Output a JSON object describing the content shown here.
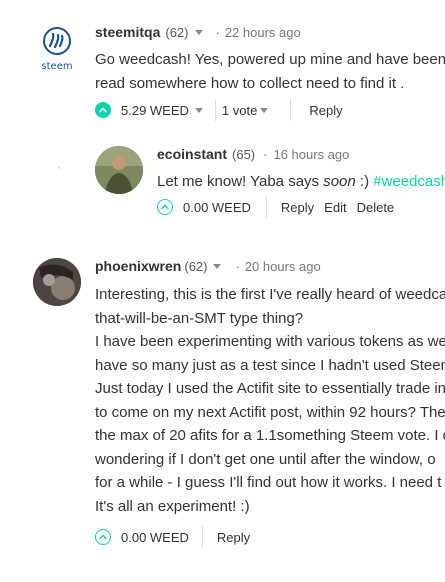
{
  "comments": [
    {
      "author": "steemitqa",
      "rep": "(62)",
      "dot": "·",
      "time": "22 hours ago",
      "avatar_label": "steem",
      "lines": [
        "Go weedcash! Yes, powered up mine and have been",
        "read somewhere how to collect need to find it ."
      ],
      "payout": "5.29 WEED",
      "votes": "1 vote",
      "reply": "Reply"
    },
    {
      "author": "ecoinstant",
      "rep": "(65)",
      "dot": "·",
      "time": "16 hours ago",
      "text_prefix": "Let me know! Yaba says ",
      "text_italic": "soon",
      "text_mid": " :) ",
      "text_tag": "#weedcash",
      "payout": "0.00 WEED",
      "reply": "Reply",
      "edit": "Edit",
      "delete": "Delete"
    },
    {
      "author": "phoenixwren",
      "rep": "(62)",
      "dot": "·",
      "time": "20 hours ago",
      "lines": [
        "Interesting, this is the first I've really heard of weedca",
        "that-will-be-an-SMT type thing?",
        "I have been experimenting with various tokens as we",
        "have so many just as a test since I hadn't used Steem",
        "Just today I used the Actifit site to essentially trade in",
        "to come on my next Actifit post, within 92 hours? The",
        "the max of 20 afits for a 1.1something Steem vote. I c",
        "wondering if I don't get one until after the window, o",
        "for a while - I guess I'll find out how it works. I need t",
        "It's all an experiment! :)"
      ],
      "payout": "0.00 WEED",
      "reply": "Reply"
    }
  ],
  "colors": {
    "accent": "#06d6a9",
    "steem_blue": "#1a5099"
  },
  "misc": {
    "bullet": "·"
  }
}
